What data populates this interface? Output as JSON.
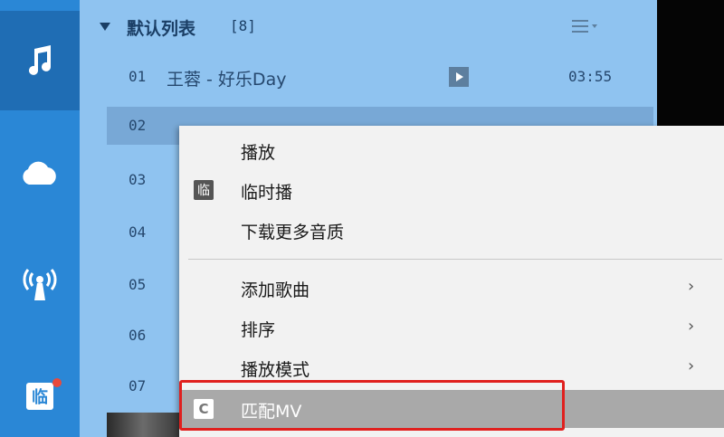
{
  "sidebar": {
    "items": [
      {
        "icon": "music-note-icon",
        "active": true
      },
      {
        "icon": "cloud-icon",
        "active": false
      },
      {
        "icon": "radio-icon",
        "active": false
      },
      {
        "icon": "temp-play-icon",
        "active": false,
        "badge": true
      }
    ]
  },
  "playlist": {
    "title": "默认列表",
    "count": "[8]",
    "tracks": [
      {
        "num": "01",
        "name": "王蓉 - 好乐Day",
        "duration": "03:55",
        "mv": true
      },
      {
        "num": "02",
        "name": "",
        "duration": "",
        "selected": true
      },
      {
        "num": "03",
        "name": "",
        "duration": ""
      },
      {
        "num": "04",
        "name": "",
        "duration": ""
      },
      {
        "num": "05",
        "name": "",
        "duration": ""
      },
      {
        "num": "06",
        "name": "",
        "duration": ""
      },
      {
        "num": "07",
        "name": "",
        "duration": ""
      }
    ]
  },
  "context_menu": {
    "items": [
      {
        "label": "播放"
      },
      {
        "label": "临时播",
        "icon": "临"
      },
      {
        "label": "下载更多音质"
      },
      {
        "label": "添加歌曲",
        "submenu": true
      },
      {
        "label": "排序",
        "submenu": true
      },
      {
        "label": "播放模式",
        "submenu": true
      },
      {
        "label": "匹配MV",
        "icon": "C",
        "highlighted": true
      }
    ],
    "submenu_arrow": "›",
    "highlight_color": "#a9a9a9",
    "annotation_color": "#e0201e"
  }
}
